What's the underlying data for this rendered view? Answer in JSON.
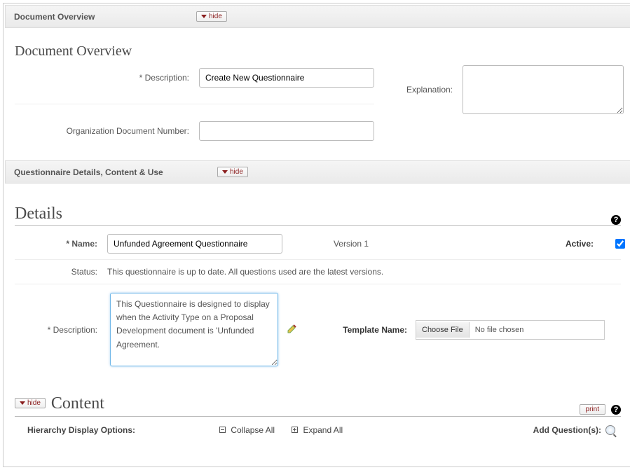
{
  "buttons": {
    "hide": "hide",
    "print": "print"
  },
  "overview": {
    "header_title": "Document Overview",
    "section_title": "Document Overview",
    "desc_label": "*   Description:",
    "desc_value": "Create New Questionnaire",
    "org_label": "Organization Document Number:",
    "org_value": "",
    "exp_label": "Explanation:",
    "exp_value": ""
  },
  "qdetails_header": "Questionnaire Details, Content & Use",
  "details": {
    "title": "Details",
    "name_label": "*  Name:",
    "name_value": "Unfunded Agreement Questionnaire",
    "version_text": "Version 1",
    "active_label": "Active:",
    "active_checked": true,
    "status_label": "Status:",
    "status_text": "This questionnaire is up to date. All questions used are the latest versions.",
    "desc_label": "*  Description:",
    "desc_value": "This Questionnaire is designed to display when the Activity Type on a Proposal Development document is 'Unfunded Agreement.",
    "template_label": "Template Name:",
    "choose_file": "Choose File",
    "no_file": "No file chosen"
  },
  "content": {
    "title": "Content",
    "hdo_label": "Hierarchy Display Options:",
    "collapse": "Collapse All",
    "expand": "Expand All",
    "addq": "Add Question(s):"
  }
}
